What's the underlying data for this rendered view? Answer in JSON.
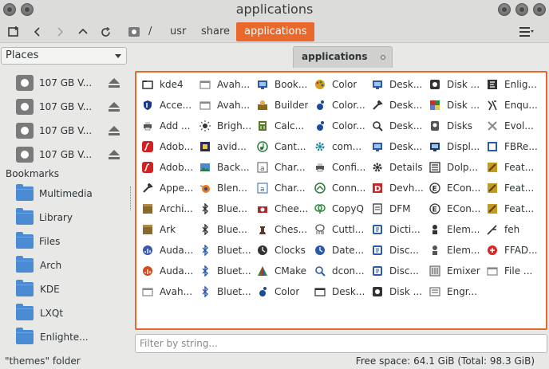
{
  "window": {
    "title": "applications"
  },
  "breadcrumb": {
    "root_sep": "/",
    "items": [
      "usr",
      "share",
      "applications"
    ]
  },
  "places": {
    "selector": "Places",
    "drives": [
      "107 GB V...",
      "107 GB V...",
      "107 GB V...",
      "107 GB V..."
    ]
  },
  "bookmarks": {
    "header": "Bookmarks",
    "items": [
      "Multimedia",
      "Library",
      "Files",
      "Arch",
      "KDE",
      "LXQt",
      "Enlighte..."
    ]
  },
  "tab": {
    "label": "applications"
  },
  "files": [
    {
      "name": "kde4",
      "icon": "folder",
      "color": "#333"
    },
    {
      "name": "Acce...",
      "icon": "shield",
      "color": "#1a3a8a"
    },
    {
      "name": "Add ...",
      "icon": "printer",
      "color": "#555"
    },
    {
      "name": "Adob...",
      "icon": "flash",
      "color": "#d42020"
    },
    {
      "name": "Adob...",
      "icon": "flash",
      "color": "#d42020"
    },
    {
      "name": "Appe...",
      "icon": "tools",
      "color": "#333"
    },
    {
      "name": "Archi...",
      "icon": "archive",
      "color": "#8a6a2a"
    },
    {
      "name": "Ark",
      "icon": "archive",
      "color": "#8a6a2a"
    },
    {
      "name": "Auda...",
      "icon": "audio",
      "color": "#3a5aaa"
    },
    {
      "name": "Auda...",
      "icon": "audio",
      "color": "#d44a1a"
    },
    {
      "name": "Avah...",
      "icon": "window",
      "color": "#888"
    },
    {
      "name": "Avah...",
      "icon": "window",
      "color": "#888"
    },
    {
      "name": "Avah...",
      "icon": "window",
      "color": "#888"
    },
    {
      "name": "Brigh...",
      "icon": "sun",
      "color": "#333"
    },
    {
      "name": "avid...",
      "icon": "film",
      "color": "#2a2a5a"
    },
    {
      "name": "Back...",
      "icon": "image",
      "color": "#2a7a3a"
    },
    {
      "name": "Blen...",
      "icon": "blender",
      "color": "#e87a1a"
    },
    {
      "name": "Blue...",
      "icon": "bluetooth",
      "color": "#333"
    },
    {
      "name": "Blue...",
      "icon": "bluetooth",
      "color": "#333"
    },
    {
      "name": "Bluet...",
      "icon": "bluetooth",
      "color": "#2a5aaa"
    },
    {
      "name": "Bluet...",
      "icon": "bluetooth",
      "color": "#2a5aaa"
    },
    {
      "name": "Bluet...",
      "icon": "bluetooth",
      "color": "#2a5aaa"
    },
    {
      "name": "Book...",
      "icon": "monitor",
      "color": "#2a5aaa"
    },
    {
      "name": "Builder",
      "icon": "builder",
      "color": "#8a6a1a"
    },
    {
      "name": "Calc...",
      "icon": "calc",
      "color": "#5a7a2a"
    },
    {
      "name": "Cant...",
      "icon": "music",
      "color": "#2a7a3a"
    },
    {
      "name": "Char...",
      "icon": "charmap",
      "color": "#555"
    },
    {
      "name": "Char...",
      "icon": "charmap",
      "color": "#2a6aaa"
    },
    {
      "name": "Chee...",
      "icon": "camera",
      "color": "#aa2a2a"
    },
    {
      "name": "Ches...",
      "icon": "chess",
      "color": "#5a3a2a"
    },
    {
      "name": "Clocks",
      "icon": "clock",
      "color": "#333"
    },
    {
      "name": "CMake",
      "icon": "cmake",
      "color": "#2a8a3a"
    },
    {
      "name": "Color",
      "icon": "gnome",
      "color": "#1a4a9a"
    },
    {
      "name": "Color",
      "icon": "palette",
      "color": "#d4a21a"
    },
    {
      "name": "Color...",
      "icon": "gnome",
      "color": "#1a4a9a"
    },
    {
      "name": "Color...",
      "icon": "gnome",
      "color": "#1a4a9a"
    },
    {
      "name": "com...",
      "icon": "gear",
      "color": "#2a8a9a"
    },
    {
      "name": "Confi...",
      "icon": "printer",
      "color": "#555"
    },
    {
      "name": "Conn...",
      "icon": "connect",
      "color": "#2a7a3a"
    },
    {
      "name": "CopyQ",
      "icon": "copyq",
      "color": "#2a8a3a"
    },
    {
      "name": "Cuttl...",
      "icon": "cuttle",
      "color": "#555"
    },
    {
      "name": "Date...",
      "icon": "clock",
      "color": "#2a5aaa"
    },
    {
      "name": "dcon...",
      "icon": "search",
      "color": "#2a5aaa"
    },
    {
      "name": "Desk...",
      "icon": "window",
      "color": "#333"
    },
    {
      "name": "Desk...",
      "icon": "monitor",
      "color": "#2a5aaa"
    },
    {
      "name": "Desk...",
      "icon": "tools",
      "color": "#333"
    },
    {
      "name": "Desk...",
      "icon": "search",
      "color": "#333"
    },
    {
      "name": "Desk...",
      "icon": "monitor",
      "color": "#2a5aaa"
    },
    {
      "name": "Details",
      "icon": "gear",
      "color": "#333"
    },
    {
      "name": "Devh...",
      "icon": "devhelp",
      "color": "#c42a2a"
    },
    {
      "name": "DFM",
      "icon": "dfm",
      "color": "#333"
    },
    {
      "name": "Dicti...",
      "icon": "dict",
      "color": "#2a5aaa"
    },
    {
      "name": "Disc...",
      "icon": "dict",
      "color": "#2a5aaa"
    },
    {
      "name": "Disc...",
      "icon": "dict",
      "color": "#2a5aaa"
    },
    {
      "name": "Disk ...",
      "icon": "disk",
      "color": "#333"
    },
    {
      "name": "Disk ...",
      "icon": "disk",
      "color": "#333"
    },
    {
      "name": "Disk ...",
      "icon": "diskcolor",
      "color": "#5a7ad4"
    },
    {
      "name": "Disks",
      "icon": "disks",
      "color": "#555"
    },
    {
      "name": "Displ...",
      "icon": "monitor",
      "color": "#1a3a6a"
    },
    {
      "name": "Dolp...",
      "icon": "dolphin",
      "color": "#333"
    },
    {
      "name": "ECon...",
      "icon": "econ",
      "color": "#333"
    },
    {
      "name": "ECon...",
      "icon": "econ",
      "color": "#333"
    },
    {
      "name": "Elem...",
      "icon": "elem",
      "color": "#333"
    },
    {
      "name": "Elem...",
      "icon": "elem",
      "color": "#555"
    },
    {
      "name": "Emixer",
      "icon": "emixer",
      "color": "#555"
    },
    {
      "name": "Engr...",
      "icon": "engr",
      "color": "#555"
    },
    {
      "name": "Enlig...",
      "icon": "enlig",
      "color": "#333"
    },
    {
      "name": "Enqu...",
      "icon": "enqu",
      "color": "#333"
    },
    {
      "name": "Evol...",
      "icon": "evol",
      "color": "#888"
    },
    {
      "name": "FBRe...",
      "icon": "fbre",
      "color": "#2a5aaa"
    },
    {
      "name": "Feat...",
      "icon": "feat",
      "color": "#c49a1a"
    },
    {
      "name": "Feat...",
      "icon": "feat",
      "color": "#c49a1a"
    },
    {
      "name": "Feat...",
      "icon": "feat",
      "color": "#c49a1a"
    },
    {
      "name": "feh",
      "icon": "feh",
      "color": "#333"
    },
    {
      "name": "FFAD...",
      "icon": "ffad",
      "color": "#d42a2a"
    },
    {
      "name": "File ...",
      "icon": "window",
      "color": "#888"
    }
  ],
  "filter": {
    "placeholder": "Filter by string..."
  },
  "status": {
    "selection": "\"themes\" folder",
    "free_space": "Free space: 64.1 GiB (Total: 98.3 GiB)"
  },
  "colors": {
    "accent": "#e9682c",
    "folder": "#4a8bd4"
  }
}
